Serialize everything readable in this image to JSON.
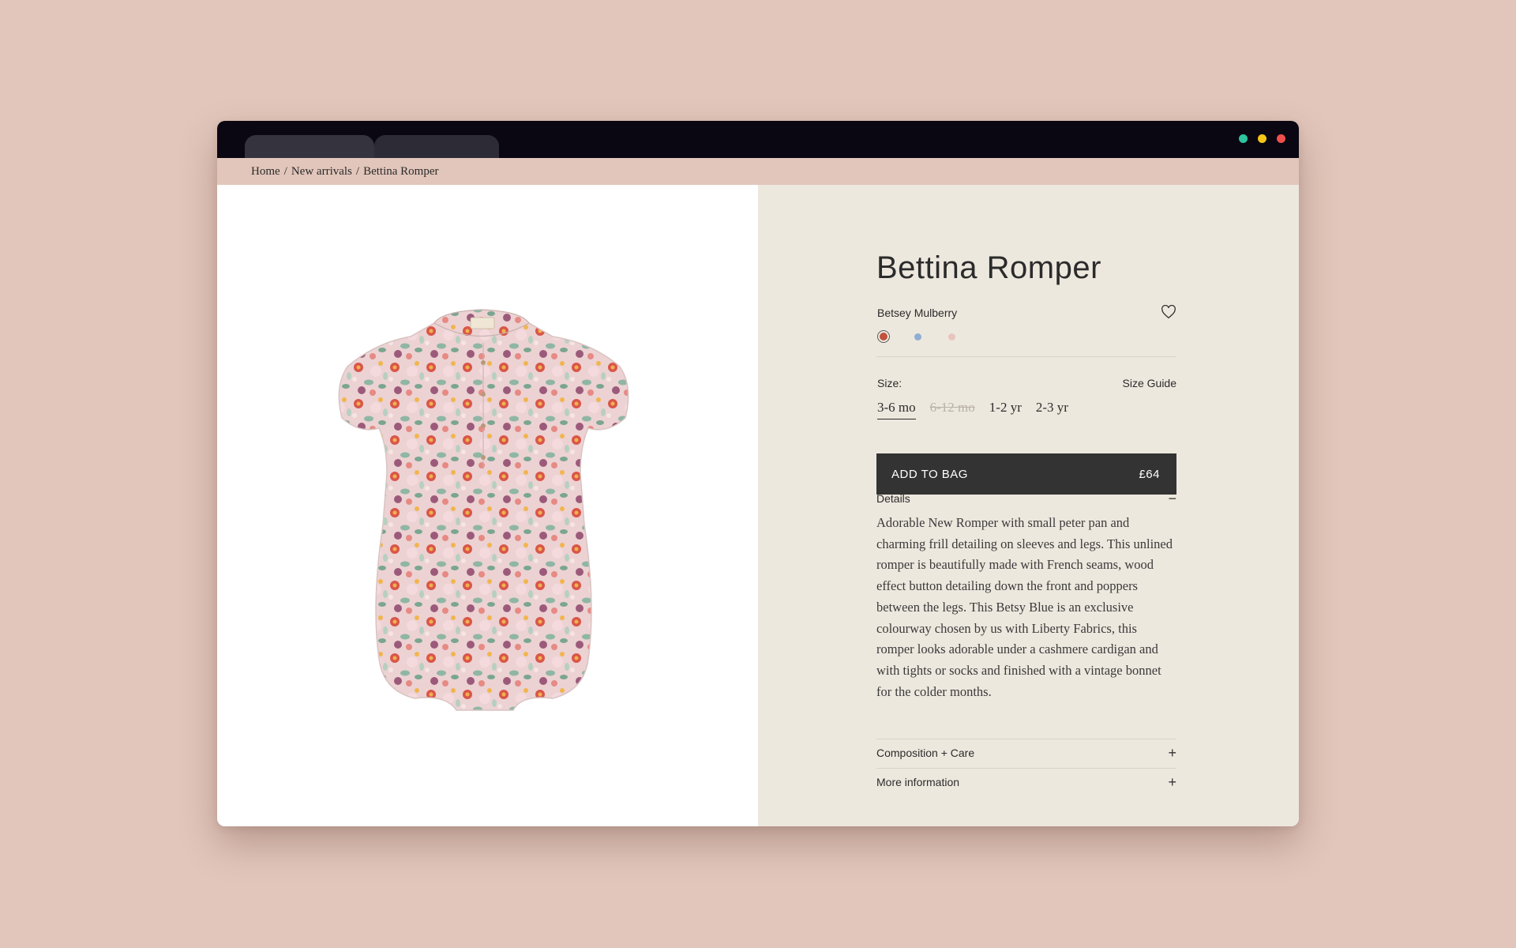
{
  "window": {
    "tabs": [
      {
        "label": ""
      },
      {
        "label": ""
      }
    ],
    "traffic_lights": [
      "#2ec4a0",
      "#f5c518",
      "#f0504c"
    ]
  },
  "breadcrumb": {
    "items": [
      "Home",
      "New arrivals",
      "Bettina Romper"
    ],
    "separator": "/"
  },
  "product": {
    "title": "Bettina Romper",
    "colour_name": "Betsey Mulberry",
    "colours": [
      {
        "name": "mulberry",
        "hex": "#c0523e",
        "selected": true
      },
      {
        "name": "blue",
        "hex": "#8eaed2",
        "selected": false
      },
      {
        "name": "pink",
        "hex": "#e9c3bd",
        "selected": false
      }
    ],
    "size_label": "Size:",
    "size_guide_label": "Size Guide",
    "sizes": [
      {
        "label": "3-6 mo",
        "state": "active"
      },
      {
        "label": "6-12 mo",
        "state": "disabled"
      },
      {
        "label": "1-2 yr",
        "state": "available"
      },
      {
        "label": "2-3 yr",
        "state": "available"
      }
    ],
    "add_to_bag_label": "ADD TO BAG",
    "price": "£64"
  },
  "accordion": {
    "details": {
      "label": "Details",
      "sign": "−",
      "body": "Adorable New Romper with small peter pan and charming frill detailing on sleeves and legs.  This unlined romper is beautifully made with French seams, wood effect button detailing down the front and poppers between the legs.  This Betsy Blue is an exclusive colourway chosen by us with Liberty Fabrics, this romper looks adorable under a cashmere cardigan and with tights or socks and finished with a vintage bonnet for the colder months."
    },
    "composition": {
      "label": "Composition + Care",
      "sign": "+"
    },
    "more_info": {
      "label": "More information",
      "sign": "+"
    }
  },
  "colors": {
    "background": "#e2c6bb",
    "titlebar": "#0a0712",
    "info_panel": "#ede8de",
    "button": "#333333"
  }
}
